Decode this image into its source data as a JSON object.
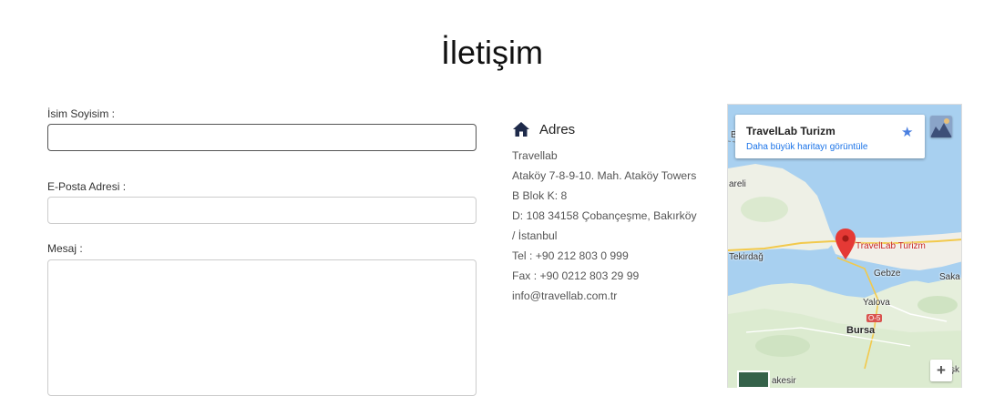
{
  "page": {
    "title": "İletişim"
  },
  "form": {
    "name_label": "İsim Soyisim :",
    "email_label": "E-Posta Adresi :",
    "message_label": "Mesaj :",
    "name_value": "",
    "email_value": "",
    "message_value": ""
  },
  "address": {
    "icon": "home-icon",
    "title": "Adres",
    "lines": [
      "Travellab",
      "Ataköy 7-8-9-10. Mah. Ataköy Towers",
      "B Blok K: 8",
      "D: 108 34158 Çobançeşme, Bakırköy",
      "/ İstanbul",
      "Tel : +90 212 803 0 999",
      "Fax : +90 0212 803 29 99",
      "info@travellab.com.tr"
    ]
  },
  "map": {
    "place_name": "TravelLab Turizm",
    "larger_map_link": "Daha büyük haritayı görüntüle",
    "marker_label": "TravelLab Turizm",
    "zoom_in": "+",
    "labels": {
      "b": "B",
      "areli": "areli",
      "tekirdag": "Tekirdağ",
      "gebze": "Gebze",
      "saka": "Saka",
      "yalova": "Yalova",
      "road": "O-5",
      "bursa": "Bursa",
      "akesir": "akesir",
      "sk": "şk"
    },
    "colors": {
      "water": "#a8d0f0",
      "land": "#f1efe8",
      "marker": "#e53935",
      "link": "#1a73e8"
    }
  }
}
